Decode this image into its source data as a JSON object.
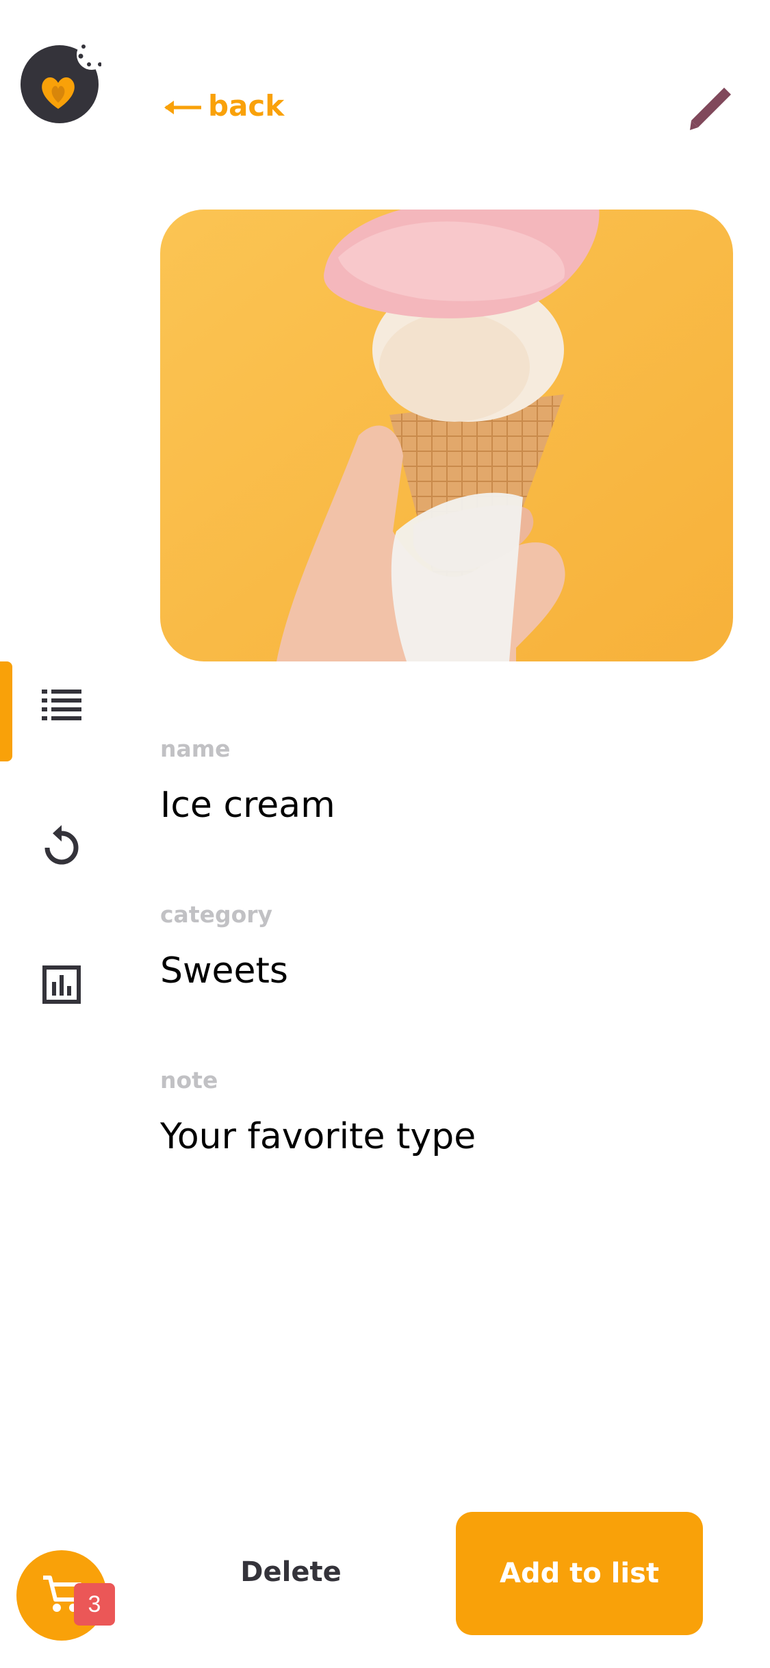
{
  "header": {
    "back_label": "back",
    "back_icon": "arrow-left-icon",
    "edit_icon": "pencil-icon"
  },
  "sidebar": {
    "logo_icon": "bitten-heart-logo",
    "items": [
      {
        "name": "items",
        "icon": "list-icon",
        "active": true
      },
      {
        "name": "history",
        "icon": "refresh-icon",
        "active": false
      },
      {
        "name": "statistics",
        "icon": "bar-chart-icon",
        "active": false
      }
    ],
    "cart": {
      "icon": "cart-icon",
      "count": "3"
    }
  },
  "item": {
    "image_alt": "Hand holding an ice cream cone against a yellow background",
    "name_label": "name",
    "name_value": "Ice cream",
    "category_label": "category",
    "category_value": "Sweets",
    "note_label": "note",
    "note_value": "Your favorite type"
  },
  "footer": {
    "delete_label": "Delete",
    "add_label": "Add to list"
  },
  "colors": {
    "accent": "#F9A109",
    "dark": "#34333A",
    "label": "#C1C1C4",
    "badge": "#EB5757",
    "edit_icon": "#80485B"
  }
}
